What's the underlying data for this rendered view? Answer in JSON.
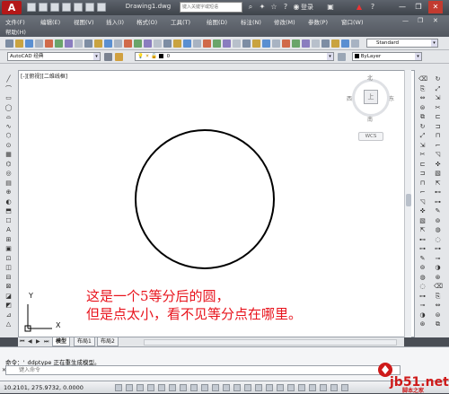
{
  "window": {
    "title": "Drawing1.dwg",
    "search_placeholder": "键入关键字或短语",
    "login_label": "登录"
  },
  "menus": {
    "row1": [
      "文件(F)",
      "编辑(E)",
      "视图(V)",
      "插入(I)",
      "格式(O)",
      "工具(T)",
      "绘图(D)",
      "标注(N)",
      "修改(M)",
      "参数(P)",
      "窗口(W)"
    ],
    "row2": [
      "帮助(H)"
    ]
  },
  "toolbar": {
    "text_style": "Standard",
    "workspace": "AutoCAD 经典",
    "layer": "0",
    "color": "ByLayer"
  },
  "viewport": {
    "label": "[-][俯视][二维线框]"
  },
  "viewcube": {
    "north": "北",
    "south": "南",
    "east": "东",
    "west": "西",
    "top_face": "上",
    "wcs": "WCS"
  },
  "ucs": {
    "x": "X",
    "y": "Y"
  },
  "annotation": {
    "line1": "这是一个5等分后的圆，",
    "line2": "但是点太小，看不见等分点在哪里。"
  },
  "tabs": [
    "模型",
    "布局1",
    "布局2"
  ],
  "command": {
    "history": "命令：'_ddptype 正在重生成模型。",
    "placeholder": "键入命令"
  },
  "status": {
    "coordinates": "10.2101, 275.9732, 0.0000"
  },
  "watermark": {
    "name": "脚本之家",
    "site": "jb51.net"
  },
  "colors": {
    "annotation": "#e8131c",
    "canvas": "#ffffff",
    "titlebar": "#4a4e55"
  }
}
